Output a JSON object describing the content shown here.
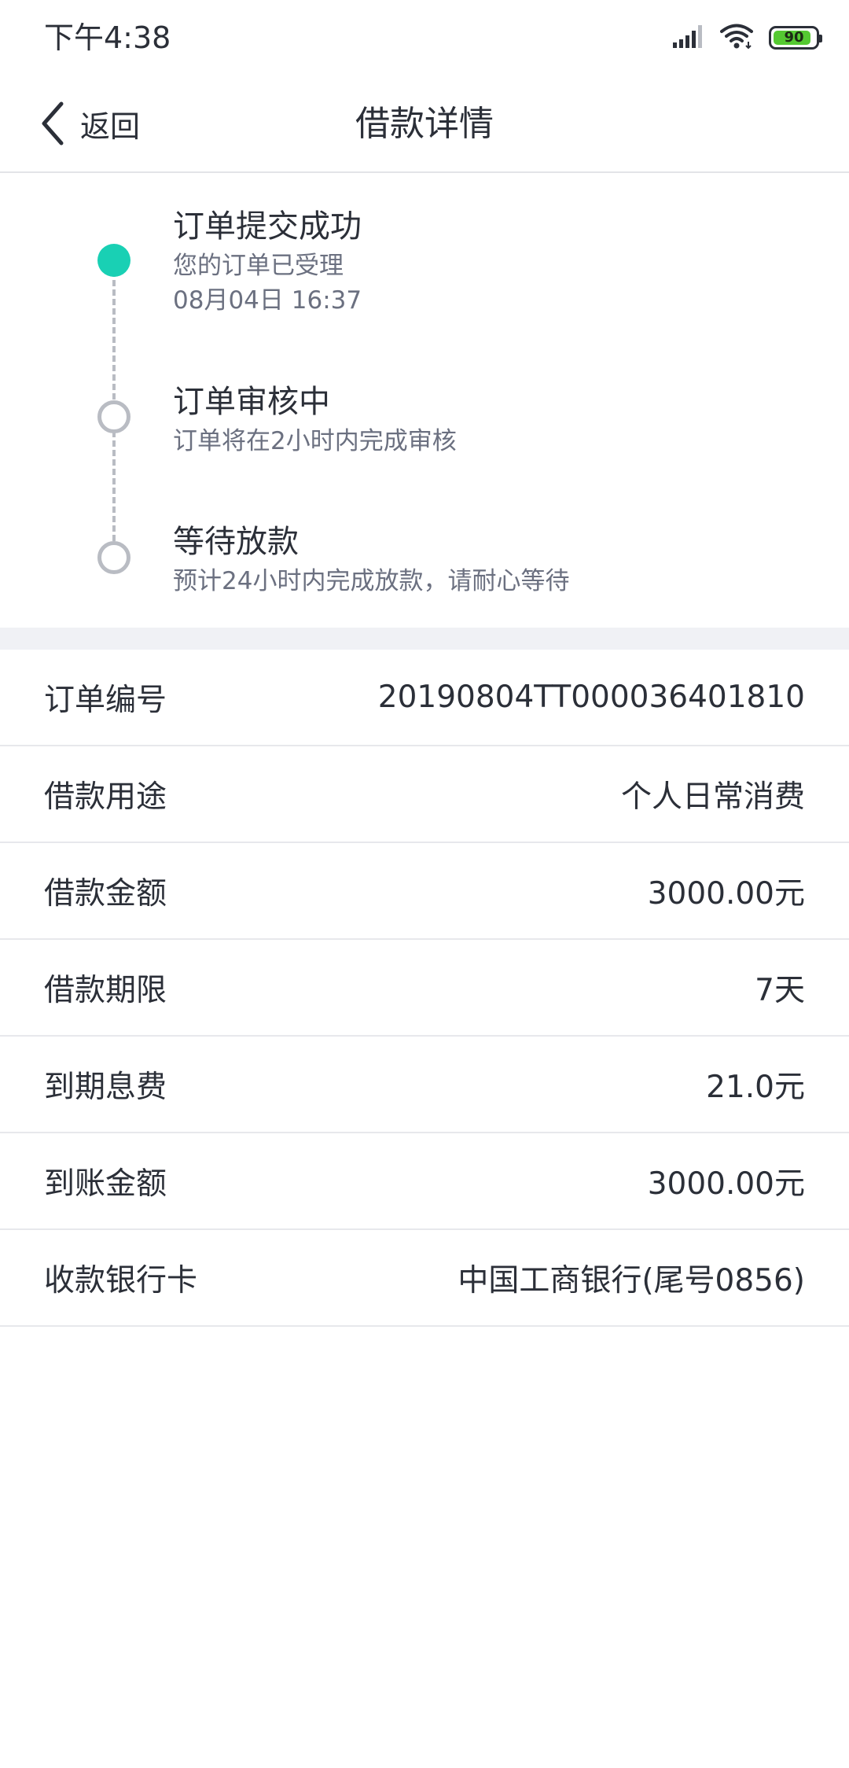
{
  "status_bar": {
    "time": "下午4:38",
    "battery_level": "90",
    "icons": [
      "signal-icon",
      "wifi-icon",
      "battery-icon"
    ],
    "battery_color": "#55c932"
  },
  "nav": {
    "back_label": "返回",
    "title": "借款详情"
  },
  "timeline": {
    "accent_color": "#19d0b4",
    "steps": [
      {
        "title": "订单提交成功",
        "desc": "您的订单已受理",
        "time": "08月04日 16:37",
        "status": "done"
      },
      {
        "title": "订单审核中",
        "desc": "订单将在2小时内完成审核",
        "status": "pending"
      },
      {
        "title": "等待放款",
        "desc": "预计24小时内完成放款，请耐心等待",
        "status": "pending"
      }
    ]
  },
  "details": [
    {
      "label": "订单编号",
      "value": "20190804TT000036401810"
    },
    {
      "label": "借款用途",
      "value": "个人日常消费"
    },
    {
      "label": "借款金额",
      "value": "3000.00元"
    },
    {
      "label": "借款期限",
      "value": "7天"
    },
    {
      "label": "到期息费",
      "value": "21.0元"
    },
    {
      "label": "到账金额",
      "value": "3000.00元"
    },
    {
      "label": "收款银行卡",
      "value": "中国工商银行(尾号0856)"
    }
  ]
}
